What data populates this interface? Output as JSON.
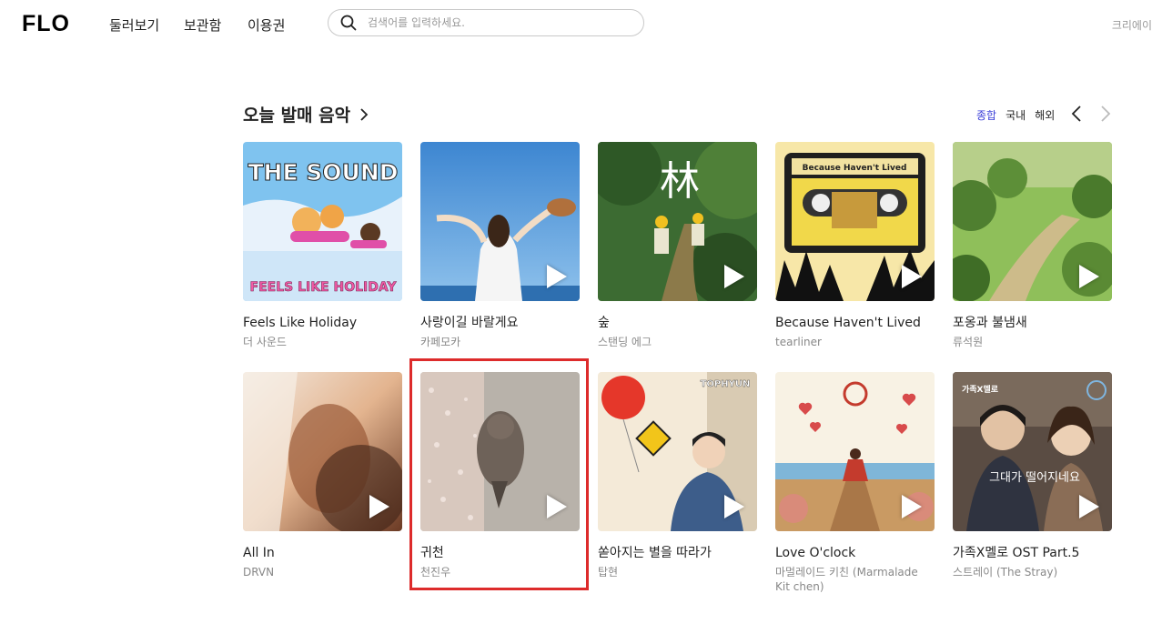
{
  "header": {
    "logo": "FLO",
    "nav": [
      "둘러보기",
      "보관함",
      "이용권"
    ],
    "search_placeholder": "검색어를 입력하세요.",
    "creator_label": "크리에이"
  },
  "section": {
    "title": "오늘 발매 음악",
    "filters": [
      "종합",
      "국내",
      "해외"
    ],
    "active_filter": "종합"
  },
  "albums": [
    {
      "title": "Feels Like Holiday",
      "artist": "더 사운드"
    },
    {
      "title": "사랑이길 바랄게요",
      "artist": "카페모카"
    },
    {
      "title": "숲",
      "artist": "스탠딩 에그"
    },
    {
      "title": "Because Haven't Lived",
      "artist": "tearliner"
    },
    {
      "title": "포옹과 불냄새",
      "artist": "류석원"
    },
    {
      "title": "All In",
      "artist": "DRVN"
    },
    {
      "title": "귀천",
      "artist": "천진우"
    },
    {
      "title": "쏟아지는 별을 따라가",
      "artist": "탑현"
    },
    {
      "title": "Love O'clock",
      "artist": "마멀레이드 키친 (Marmalade Kit chen)"
    },
    {
      "title": "가족X멜로 OST Part.5",
      "artist": "스트레이 (The Stray)"
    }
  ],
  "cover_art": {
    "a0_top": "THE SOUND",
    "a0_bottom": "FEELS LIKE HOLIDAY",
    "a2_text": "林",
    "a3_text": "Because Haven't Lived",
    "a7_text": "TOPHYUN",
    "a9_text": "가족X멜로",
    "a9_title": "그대가 떨어지네요"
  }
}
